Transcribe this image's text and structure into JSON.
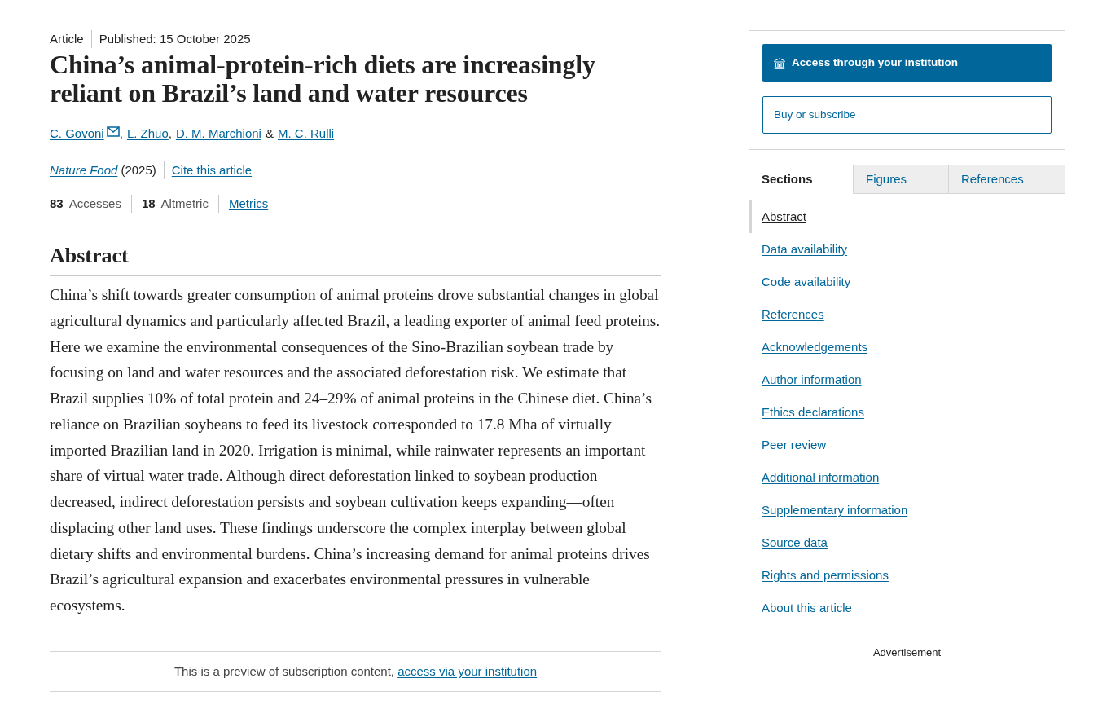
{
  "article_header": {
    "type": "Article",
    "published": "Published: 15 October 2025",
    "title": "China’s animal-protein-rich diets are increasingly reliant on Brazil’s land and water resources"
  },
  "authors": [
    {
      "name": "C. Govoni",
      "contact": true,
      "sep": ","
    },
    {
      "name": "L. Zhuo",
      "contact": false,
      "sep": ","
    },
    {
      "name": "D. M. Marchioni",
      "contact": false,
      "sep": "&"
    },
    {
      "name": "M. C. Rulli",
      "contact": false
    }
  ],
  "citation": {
    "journal": "Nature Food",
    "year": "(2025)",
    "cite_link": "Cite this article"
  },
  "metrics": {
    "items": [
      {
        "count": "83",
        "name": "Accesses"
      },
      {
        "count": "18",
        "name": "Altmetric"
      }
    ],
    "link": "Metrics"
  },
  "abstract": {
    "heading": "Abstract",
    "text": "China’s shift towards greater consumption of animal proteins drove substantial changes in global agricultural dynamics and particularly affected Brazil, a leading exporter of animal feed proteins. Here we examine the environmental consequences of the Sino-Brazilian soybean trade by focusing on land and water resources and the associated deforestation risk. We estimate that Brazil supplies 10% of total protein and 24–29% of animal proteins in the Chinese diet. China’s reliance on Brazilian soybeans to feed its livestock corresponded to 17.8 Mha of virtually imported Brazilian land in 2020. Irrigation is minimal, while rainwater represents an important share of virtual water trade. Although direct deforestation linked to soybean production decreased, indirect deforestation persists and soybean cultivation keeps expanding—often displacing other land uses. These findings underscore the complex interplay between global dietary shifts and environmental burdens. China’s increasing demand for animal proteins drives Brazil’s agricultural expansion and exacerbates environmental pressures in vulnerable ecosystems."
  },
  "preview_notice": {
    "text": "This is a preview of subscription content,",
    "link": "access via your institution"
  },
  "access_box": {
    "institution_button": "Access through your institution",
    "buy_button": "Buy or subscribe"
  },
  "tabs": [
    {
      "label": "Sections",
      "selected": true
    },
    {
      "label": "Figures",
      "selected": false
    },
    {
      "label": "References",
      "selected": false
    }
  ],
  "sections": [
    {
      "label": "Abstract",
      "selected": true
    },
    {
      "label": "Data availability",
      "selected": false
    },
    {
      "label": "Code availability",
      "selected": false
    },
    {
      "label": "References",
      "selected": false
    },
    {
      "label": "Acknowledgements",
      "selected": false
    },
    {
      "label": "Author information",
      "selected": false
    },
    {
      "label": "Ethics declarations",
      "selected": false
    },
    {
      "label": "Peer review",
      "selected": false
    },
    {
      "label": "Additional information",
      "selected": false
    },
    {
      "label": "Supplementary information",
      "selected": false
    },
    {
      "label": "Source data",
      "selected": false
    },
    {
      "label": "Rights and permissions",
      "selected": false
    },
    {
      "label": "About this article",
      "selected": false
    }
  ],
  "advertisement": "Advertisement"
}
